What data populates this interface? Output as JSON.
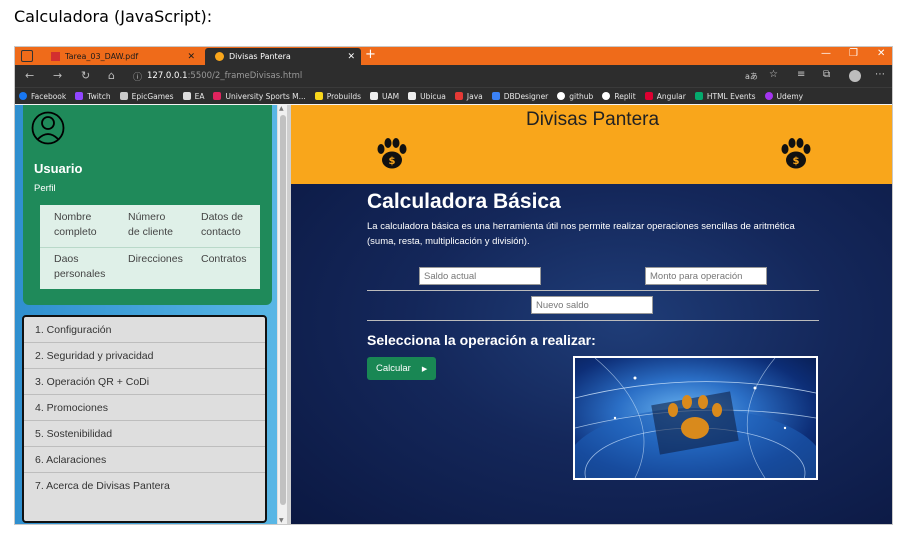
{
  "doc_heading": "Calculadora (JavaScript):",
  "browser": {
    "tabs": [
      {
        "label": "Tarea_03_DAW.pdf"
      },
      {
        "label": "Divisas Pantera"
      }
    ],
    "url_host": "127.0.0.1",
    "url_path": ":5500/2_frameDivisas.html",
    "bookmarks": [
      {
        "label": "Facebook",
        "color": "#1877f2"
      },
      {
        "label": "Twitch",
        "color": "#9146ff"
      },
      {
        "label": "EpicGames",
        "color": "#cccccc"
      },
      {
        "label": "EA",
        "color": "#dddddd"
      },
      {
        "label": "University Sports M...",
        "color": "#e0245e"
      },
      {
        "label": "Probuilds",
        "color": "#333333"
      },
      {
        "label": "UAM",
        "color": "#444444"
      },
      {
        "label": "Ubicua",
        "color": "#666666"
      },
      {
        "label": "Java",
        "color": "#e53935"
      },
      {
        "label": "DBDesigner",
        "color": "#3b82f6"
      },
      {
        "label": "github",
        "color": "#ffffff"
      },
      {
        "label": "Replit",
        "color": "#f26207"
      },
      {
        "label": "Angular",
        "color": "#dd0031"
      },
      {
        "label": "HTML Events",
        "color": "#04aa6d"
      },
      {
        "label": "Udemy",
        "color": "#a435f0"
      }
    ]
  },
  "sidebar": {
    "user_name": "Usuario",
    "user_sub": "Perfil",
    "profile_links": [
      [
        "Nombre",
        "completo"
      ],
      [
        "Número",
        "de cliente"
      ],
      [
        "Datos de",
        "contacto"
      ],
      [
        "Daos",
        "personales"
      ],
      [
        "Direcciones"
      ],
      [
        "Contratos"
      ]
    ],
    "menu": [
      "1. Configuración",
      "2. Seguridad y privacidad",
      "3. Operación QR + CoDi",
      "4. Promociones",
      "5. Sostenibilidad",
      "6. Aclaraciones",
      "7. Acerca de Divisas Pantera"
    ]
  },
  "main": {
    "site_title": "Divisas Pantera",
    "calc_title": "Calculadora Básica",
    "calc_desc": "La calculadora básica es una herramienta útil nos permite realizar operaciones sencillas de aritmética (suma, resta, multiplicación y división).",
    "saldo_placeholder": "Saldo actual",
    "monto_placeholder": "Monto para operación",
    "nuevo_placeholder": "Nuevo saldo",
    "select_title": "Selecciona la operación a realizar:",
    "calc_button": "Calcular"
  },
  "colors": {
    "tab_bar": "#ef6b1a",
    "header": "#f9a61b",
    "user_card": "#1f8a5a",
    "button": "#198754"
  }
}
